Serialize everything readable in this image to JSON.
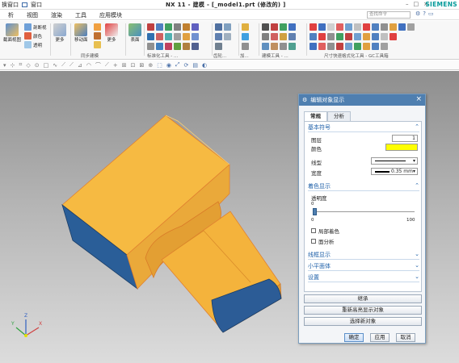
{
  "titlebar": {
    "left_a": "换窗口",
    "left_b": "窗口",
    "title": "NX 11 - 建模 - [_model1.prt (修改的) ]",
    "brand": "SIEMENS",
    "min": "–",
    "max": "□",
    "close": "×"
  },
  "menubar": {
    "items": [
      "析",
      "视图",
      "渲染",
      "工具",
      "应用模块"
    ],
    "search_placeholder": "查找命令"
  },
  "ribbon": {
    "g1_btn": "截面视图",
    "g1_a": "剖断视",
    "g1_b": "颜色",
    "g1_c": "透明",
    "g2_btn": "更多",
    "g3_btn": "移动面",
    "g3_more": "更多",
    "g3_label": "同步建模",
    "g4_btn": "表面",
    "g5_label": "标准化工具 - ...",
    "g6_label": "齿轮...",
    "g7_label": "加...",
    "g8_label": "建模工具 - ...",
    "g9_label": "尺寸快速格式化工具 - GC工具箱"
  },
  "dialog": {
    "title": "编辑对象显示",
    "tab_general": "常规",
    "tab_analysis": "分析",
    "sec_basic": "基本符号",
    "layer_label": "图层",
    "layer_value": "1",
    "color_label": "颜色",
    "color_value": "#ffff00",
    "linetype_label": "线型",
    "linewidth_label": "宽度",
    "linewidth_value": "0.35 mm",
    "sec_shading": "着色显示",
    "transparency_label": "透明度",
    "slider_min": "0",
    "slider_max": "100",
    "slider_value": "0",
    "local_shade": "局部着色",
    "face_analysis": "面分析",
    "sec_wire": "线框显示",
    "sec_facet": "小平面体",
    "sec_settings": "设置",
    "btn_inherit": "继承",
    "btn_rehighlight": "重新高亮显示对象",
    "btn_select_new": "选择新对象",
    "btn_ok": "确定",
    "btn_apply": "应用",
    "btn_cancel": "取消"
  },
  "axes": {
    "x": "X",
    "y": "Y",
    "z": "Z"
  },
  "colors": {
    "part_face": "#f4b840",
    "part_side": "#2b5f99",
    "dialog_header": "#4f7fb0",
    "accent": "#009999"
  }
}
